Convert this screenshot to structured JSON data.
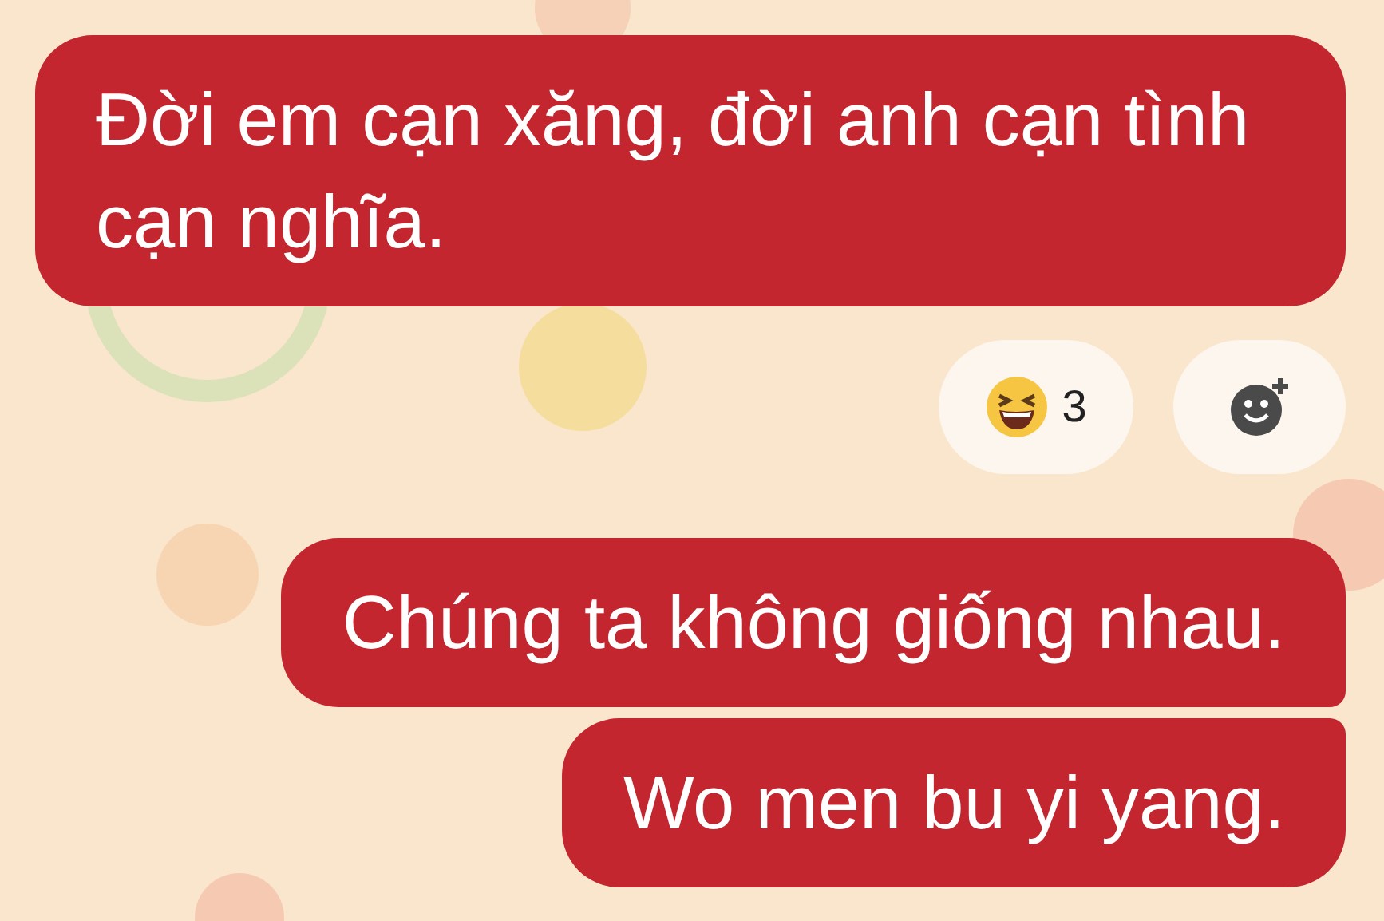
{
  "messages": [
    {
      "text": "Đời em cạn xăng, đời anh cạn tình cạn nghĩa.",
      "reaction": {
        "count": "3"
      }
    },
    {
      "text": "Chúng ta không giống nhau."
    },
    {
      "text": "Wo men bu yi yang."
    }
  ]
}
